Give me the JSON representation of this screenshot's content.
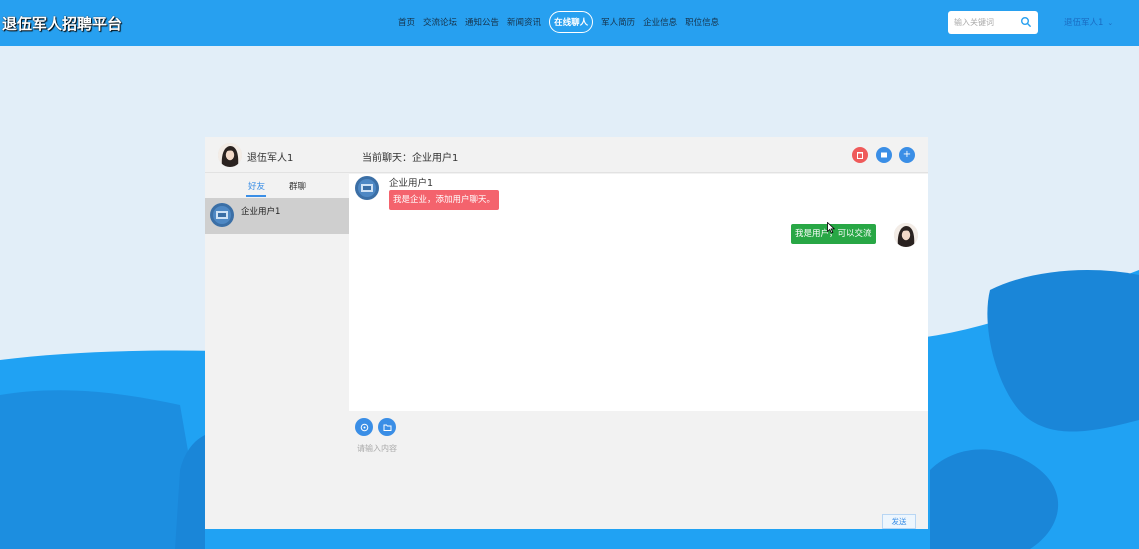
{
  "header": {
    "site_title": "退伍军人招聘平台",
    "nav": [
      {
        "label": "首页"
      },
      {
        "label": "交流论坛"
      },
      {
        "label": "通知公告"
      },
      {
        "label": "新闻资讯"
      },
      {
        "label": "在线聊人",
        "active": true
      },
      {
        "label": "军人简历"
      },
      {
        "label": "企业信息"
      },
      {
        "label": "职位信息"
      }
    ],
    "search_placeholder": "输入关键词",
    "user_label": "退伍军人1"
  },
  "chat": {
    "me_name": "退伍军人1",
    "current_chat_label": "当前聊天：企业用户1",
    "tabs": {
      "friends": "好友",
      "groups": "群聊"
    },
    "friends": [
      {
        "name": "企业用户1"
      }
    ],
    "messages": [
      {
        "side": "left",
        "sender": "企业用户1",
        "text": "我是企业，添加用户聊天。"
      },
      {
        "side": "right",
        "text": "我是用户，可以交流"
      }
    ],
    "input_placeholder": "请输入内容",
    "send_label": "发送"
  },
  "colors": {
    "header_bg": "#27a0f0",
    "left_bubble": "#f4636d",
    "right_bubble": "#28a745",
    "accent": "#3a8ee6",
    "danger": "#ef5a5a"
  }
}
